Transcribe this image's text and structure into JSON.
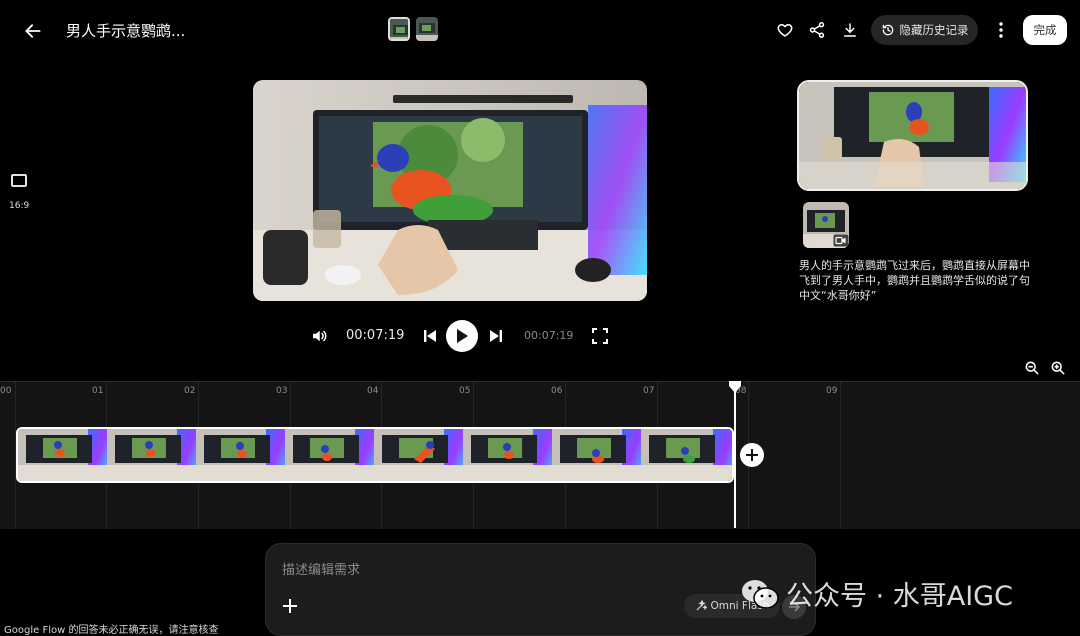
{
  "header": {
    "title": "男人手示意鹦鹉...",
    "hide_history_label": "隐藏历史记录",
    "done_label": "完成"
  },
  "aspect": {
    "label": "16:9"
  },
  "player": {
    "current_time": "00:07:19",
    "total_time": "00:07:19"
  },
  "side_panel": {
    "caption": "男人的手示意鹦鹉飞过来后，鹦鹉直接从屏幕中飞到了男人手中，鹦鹉并且鹦鹉学舌似的说了句中文“水哥你好”"
  },
  "timeline": {
    "ticks": [
      "00",
      "01",
      "02",
      "03",
      "04",
      "05",
      "06",
      "07",
      "08",
      "09"
    ]
  },
  "prompt": {
    "placeholder": "描述编辑需求",
    "model_label": "Omni Flash"
  },
  "footer": {
    "disclaimer": "Google Flow 的回答未必正确无误，请注意核查"
  },
  "watermark": {
    "text": "公众号 · 水哥AIGC"
  },
  "colors": {
    "background": "#000000",
    "timeline_bg": "#141414",
    "accent_white": "#ffffff"
  },
  "icons": [
    "arrow-left-icon",
    "heart-icon",
    "share-icon",
    "download-icon",
    "history-icon",
    "more-vert-icon",
    "aspect-ratio-icon",
    "volume-icon",
    "skip-previous-icon",
    "play-icon",
    "skip-next-icon",
    "fullscreen-icon",
    "zoom-out-icon",
    "zoom-in-icon",
    "plus-icon",
    "sparkle-icon",
    "send-icon",
    "video-badge-icon",
    "wechat-icon"
  ]
}
